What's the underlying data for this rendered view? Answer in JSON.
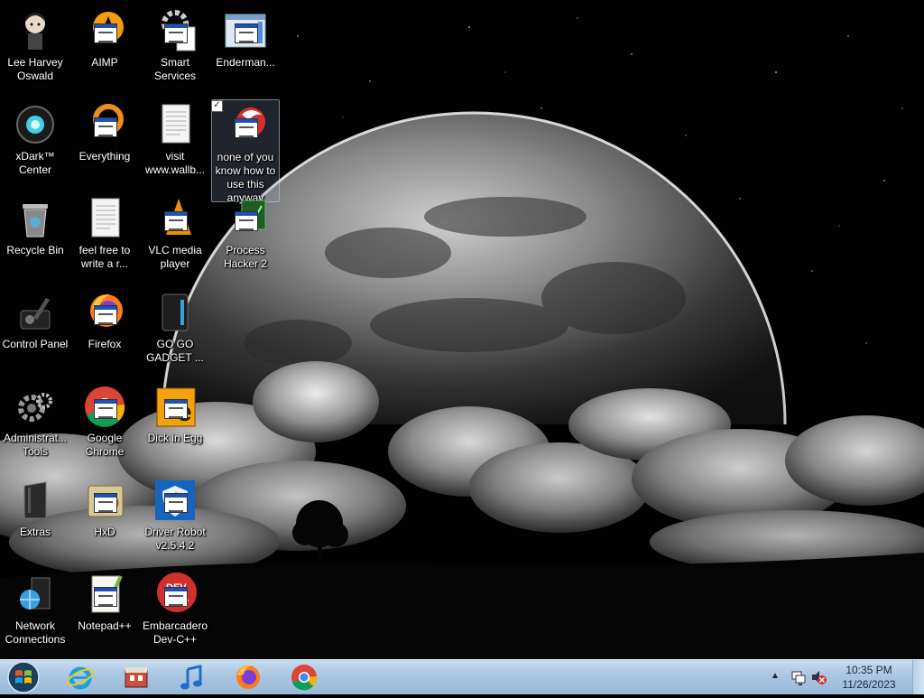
{
  "desktop": {
    "icons": [
      {
        "label": "Lee Harvey Oswald",
        "icon": "character-icon"
      },
      {
        "label": "xDark™ Center",
        "icon": "xdark-orb-icon"
      },
      {
        "label": "Recycle Bin",
        "icon": "recycle-bin-icon"
      },
      {
        "label": "Control Panel",
        "icon": "control-panel-icon"
      },
      {
        "label": "Administrat... Tools",
        "icon": "admin-tools-icon"
      },
      {
        "label": "Extras",
        "icon": "folder-icon"
      },
      {
        "label": "Network Connections",
        "icon": "network-globe-icon"
      },
      {
        "label": "AIMP",
        "icon": "aimp-icon"
      },
      {
        "label": "Everything",
        "icon": "everything-icon"
      },
      {
        "label": "feel free to write a r...",
        "icon": "text-document-icon"
      },
      {
        "label": "Firefox",
        "icon": "firefox-icon"
      },
      {
        "label": "Google Chrome",
        "icon": "chrome-icon"
      },
      {
        "label": "HxD",
        "icon": "hxd-icon"
      },
      {
        "label": "Notepad++",
        "icon": "notepad-plus-icon"
      },
      {
        "label": "Smart Services",
        "icon": "gear-icon"
      },
      {
        "label": "visit www.wallb...",
        "icon": "text-document-icon"
      },
      {
        "label": "VLC media player",
        "icon": "vlc-cone-icon"
      },
      {
        "label": "GO GO GADGET ...",
        "icon": "gadget-icon"
      },
      {
        "label": "Dick in Egg",
        "icon": "e-icon"
      },
      {
        "label": "Driver Robot v2.5.4.2",
        "icon": "shield-icon"
      },
      {
        "label": "Embarcadero Dev-C++",
        "icon": "devcpp-icon"
      },
      {
        "label": "Enderman...",
        "icon": "window-app-icon"
      },
      {
        "label": "none of you know how to use this anyway",
        "icon": "red-app-icon",
        "selected": true
      },
      {
        "label": "Process Hacker 2",
        "icon": "process-hacker-icon"
      }
    ]
  },
  "taskbar": {
    "start": {
      "icon": "windows-orb-icon"
    },
    "pinned": [
      {
        "name": "Internet Explorer",
        "icon": "ie-icon"
      },
      {
        "name": "Store",
        "icon": "store-icon"
      },
      {
        "name": "Music",
        "icon": "music-note-icon"
      },
      {
        "name": "Firefox",
        "icon": "firefox-icon"
      },
      {
        "name": "Google Chrome",
        "icon": "chrome-icon"
      }
    ],
    "tray": {
      "time": "10:35 PM",
      "date": "11/26/2023"
    }
  },
  "colors": {
    "taskbar": "#a9c6e2",
    "selection": "#8ca0be",
    "text": "#ffffff"
  }
}
